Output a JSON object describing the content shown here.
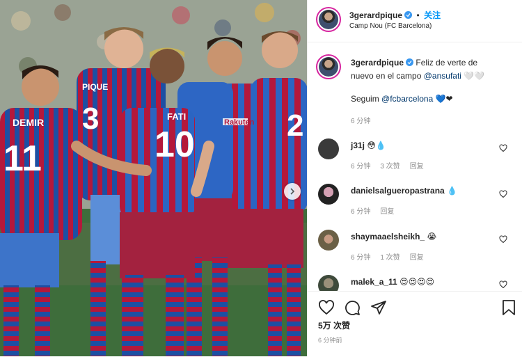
{
  "post": {
    "username": "3gerardpique",
    "follow_label": "关注",
    "dot": "•",
    "location": "Camp Nou (FC Barcelona)"
  },
  "caption": {
    "username": "3gerardpique",
    "text_line1": "Feliz de verte de",
    "text_line2": "nuevo en el campo",
    "mention": "@ansufati",
    "emoji": "🤍🤍",
    "text_line3": "Seguim",
    "mention2": "@fcbarcelona",
    "emoji2": "💙❤",
    "time": "6 分钟"
  },
  "comments": [
    {
      "username": "j31j",
      "text": "😳💧",
      "time": "6 分钟",
      "likes": "3 次赞",
      "reply": "回复"
    },
    {
      "username": "danielsalgueropastrana",
      "text": "💧",
      "time": "6 分钟",
      "likes": "",
      "reply": "回复"
    },
    {
      "username": "shaymaaelsheikh_",
      "text": "😭",
      "time": "6 分钟",
      "likes": "1 次赞",
      "reply": "回复"
    },
    {
      "username": "malek_a_11",
      "text": "😍😍😍😍",
      "time": "",
      "likes": "",
      "reply": ""
    }
  ],
  "footer": {
    "likes": "5万 次赞",
    "time_ago": "6 分钟前"
  },
  "photo": {
    "jersey_numbers": [
      "11",
      "3",
      "10",
      "2"
    ],
    "name_tags": [
      "DEMIR",
      "PIQUE",
      "FATI"
    ],
    "sponsor": "Rakuten"
  },
  "colors": {
    "accent": "#0095f6",
    "verified": "#3897f0",
    "text": "#262626",
    "muted": "#8e8e8e",
    "jersey_blue": "#1d4fa3",
    "jersey_red": "#a50044"
  }
}
